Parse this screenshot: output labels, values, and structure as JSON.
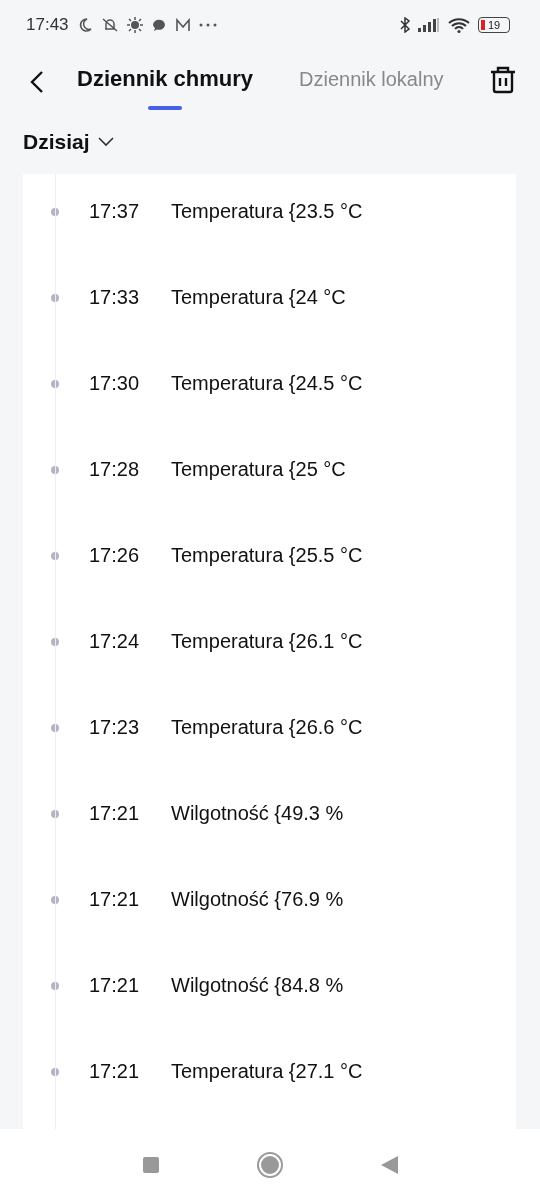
{
  "status_bar": {
    "time": "17:43",
    "battery": "19"
  },
  "header": {
    "tabs": [
      {
        "label": "Dziennik chmury",
        "selected": true
      },
      {
        "label": "Dziennik lokalny",
        "selected": false
      }
    ]
  },
  "day_filter": {
    "label": "Dzisiaj"
  },
  "log": [
    {
      "time": "17:37",
      "text": "Temperatura {23.5 °C"
    },
    {
      "time": "17:33",
      "text": "Temperatura {24 °C"
    },
    {
      "time": "17:30",
      "text": "Temperatura {24.5 °C"
    },
    {
      "time": "17:28",
      "text": "Temperatura {25 °C"
    },
    {
      "time": "17:26",
      "text": "Temperatura {25.5 °C"
    },
    {
      "time": "17:24",
      "text": "Temperatura {26.1 °C"
    },
    {
      "time": "17:23",
      "text": "Temperatura {26.6 °C"
    },
    {
      "time": "17:21",
      "text": "Wilgotność {49.3 %"
    },
    {
      "time": "17:21",
      "text": "Wilgotność {76.9 %"
    },
    {
      "time": "17:21",
      "text": "Wilgotność {84.8 %"
    },
    {
      "time": "17:21",
      "text": "Temperatura {27.1 °C"
    }
  ]
}
